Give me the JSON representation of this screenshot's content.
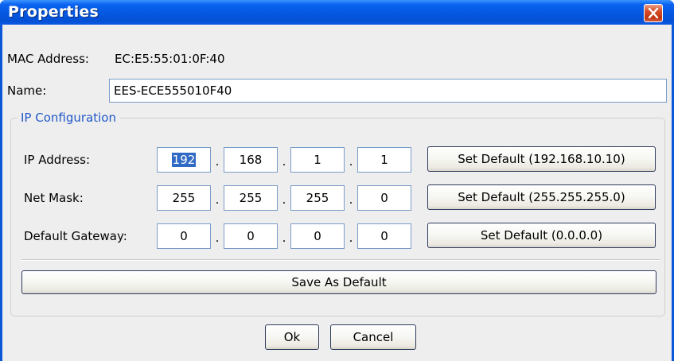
{
  "window": {
    "title": "Properties",
    "close_icon": "close-icon"
  },
  "device": {
    "mac_label": "MAC Address:",
    "mac_value": "EC:E5:55:01:0F:40",
    "name_label": "Name:",
    "name_value": "EES-ECE555010F40"
  },
  "ip_config": {
    "legend": "IP Configuration",
    "separator": ".",
    "rows": [
      {
        "label": "IP Address:",
        "octets": [
          "192",
          "168",
          "1",
          "1"
        ],
        "default_button": "Set Default (192.168.10.10)"
      },
      {
        "label": "Net Mask:",
        "octets": [
          "255",
          "255",
          "255",
          "0"
        ],
        "default_button": "Set Default (255.255.255.0)"
      },
      {
        "label": "Default Gateway:",
        "octets": [
          "0",
          "0",
          "0",
          "0"
        ],
        "default_button": "Set Default (0.0.0.0)"
      }
    ],
    "save_button": "Save As Default"
  },
  "footer": {
    "ok_button": "Ok",
    "cancel_button": "Cancel"
  },
  "colors": {
    "titlebar": "#0458e0",
    "legend": "#2358c9",
    "selection": "#316ac5",
    "close_button": "#c23512"
  }
}
